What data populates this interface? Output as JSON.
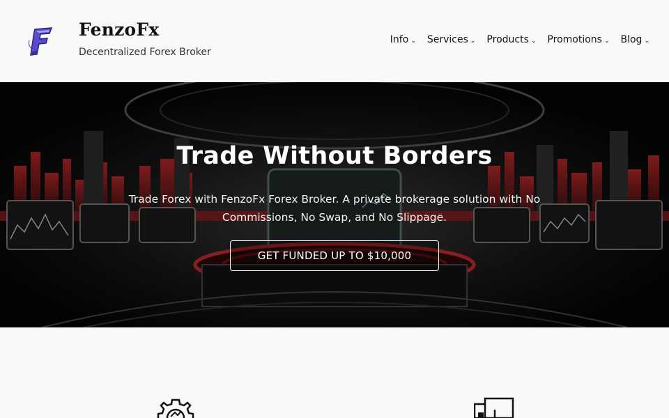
{
  "header": {
    "site_title": "FenzoFx",
    "tagline": "Decentralized Forex Broker",
    "logo_icon": "fenzofx-f-logo-icon"
  },
  "nav": {
    "items": [
      {
        "label": "Info"
      },
      {
        "label": "Services"
      },
      {
        "label": "Products"
      },
      {
        "label": "Promotions"
      },
      {
        "label": "Blog"
      }
    ],
    "chevron": "⌄"
  },
  "hero": {
    "title": "Trade Without Borders",
    "text": "Trade Forex with FenzoFx Forex Broker. A private brokerage solution with No Commissions, No Swap, and No Slippage.",
    "cta_label": "GET FUNDED UP TO $10,000"
  },
  "features": {
    "icons": [
      "gear-chart-icon",
      "document-icon"
    ]
  },
  "colors": {
    "background": "#f9f9f9",
    "hero_accent": "#c0292b",
    "text": "#111111"
  }
}
